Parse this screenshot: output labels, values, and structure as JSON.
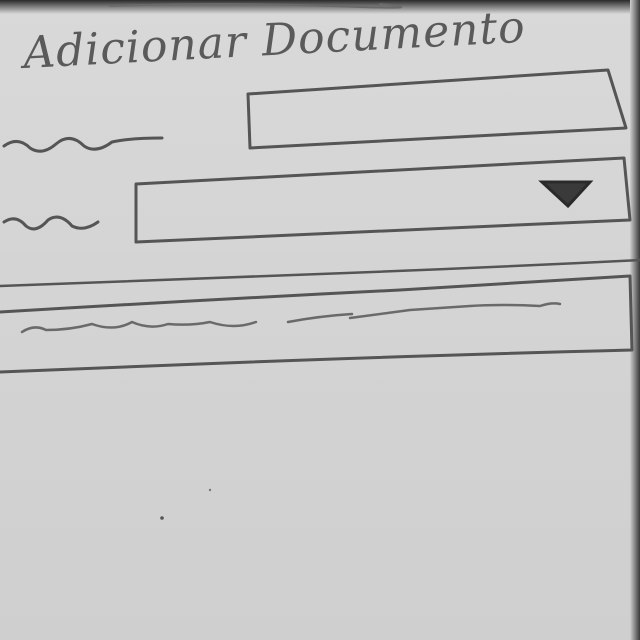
{
  "dialog": {
    "title": "Adicionar Documento"
  },
  "icons": {
    "dropdown": "dropdown-arrow-icon"
  },
  "colors": {
    "paper": "#d6d6d6",
    "ink": "#555555"
  }
}
